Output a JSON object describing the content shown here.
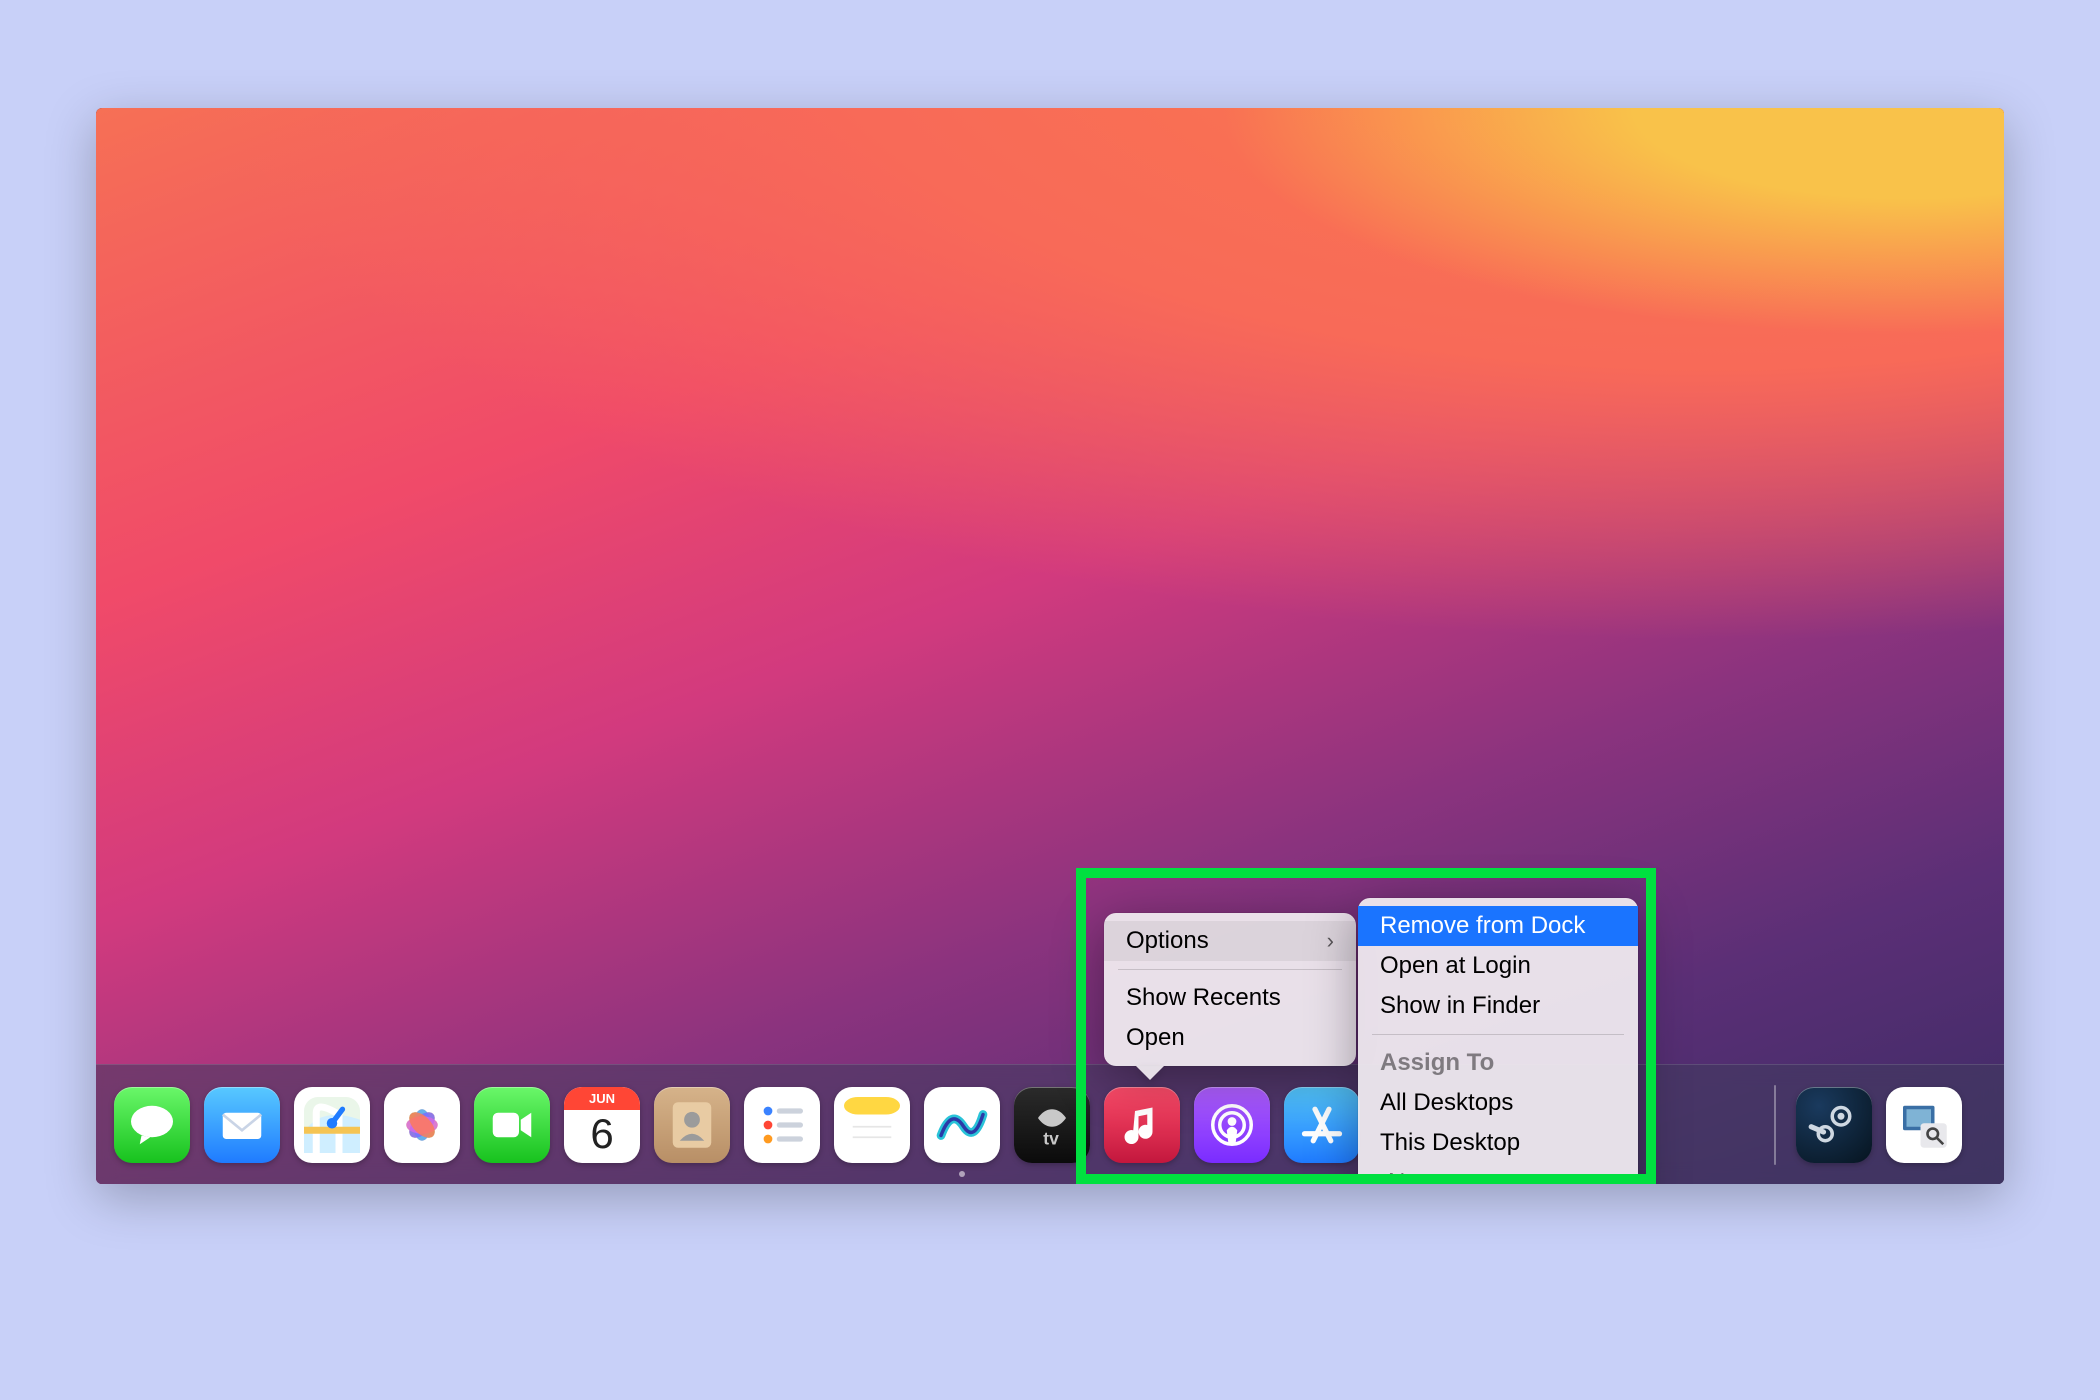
{
  "dock": {
    "icons": [
      {
        "name": "messages",
        "running": false
      },
      {
        "name": "mail",
        "running": false
      },
      {
        "name": "maps",
        "running": false
      },
      {
        "name": "photos",
        "running": false
      },
      {
        "name": "facetime",
        "running": false
      },
      {
        "name": "calendar",
        "running": false,
        "badge_month": "JUN",
        "badge_day": "6"
      },
      {
        "name": "contacts",
        "running": false
      },
      {
        "name": "reminders",
        "running": false
      },
      {
        "name": "notes",
        "running": false
      },
      {
        "name": "freeform",
        "running": true
      },
      {
        "name": "tv",
        "running": false
      },
      {
        "name": "music",
        "running": false
      },
      {
        "name": "podcasts",
        "running": false
      },
      {
        "name": "appstore",
        "running": false
      }
    ],
    "right_icons": [
      {
        "name": "steam",
        "running": false
      },
      {
        "name": "preview",
        "running": false
      }
    ]
  },
  "context_menu": {
    "options_label": "Options",
    "show_recents_label": "Show Recents",
    "open_label": "Open"
  },
  "options_submenu": {
    "remove_label": "Remove from Dock",
    "open_at_login_label": "Open at Login",
    "show_in_finder_label": "Show in Finder",
    "assign_to_header": "Assign To",
    "all_desktops_label": "All Desktops",
    "this_desktop_label": "This Desktop",
    "none_label": "None",
    "none_checked": true
  }
}
